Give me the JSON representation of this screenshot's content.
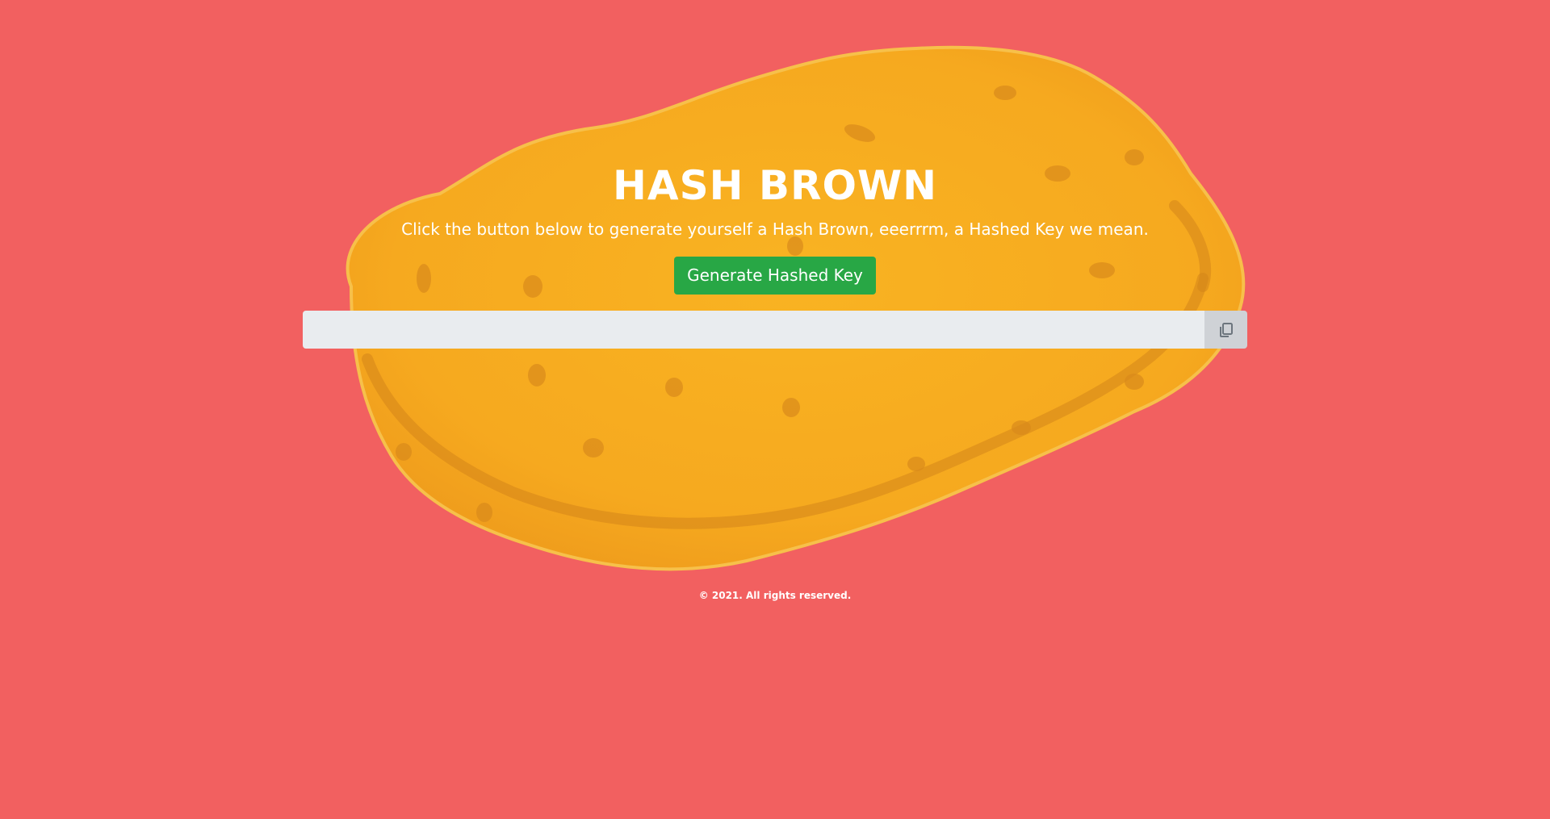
{
  "hero": {
    "title": "HASH BROWN",
    "subtitle": "Click the button below to generate yourself a Hash Brown, eeerrrm, a Hashed Key we mean.",
    "image_icon": "hash-brown-illustration"
  },
  "generator": {
    "button_label": "Generate Hashed Key",
    "key_value": "",
    "copy_icon": "copy-icon"
  },
  "footer": {
    "copyright": "© 2021. All rights reserved."
  },
  "colors": {
    "background": "#f26060",
    "accent_button": "#28a745",
    "hash_brown": "#f7b120",
    "input_bg": "#e9ecef"
  }
}
